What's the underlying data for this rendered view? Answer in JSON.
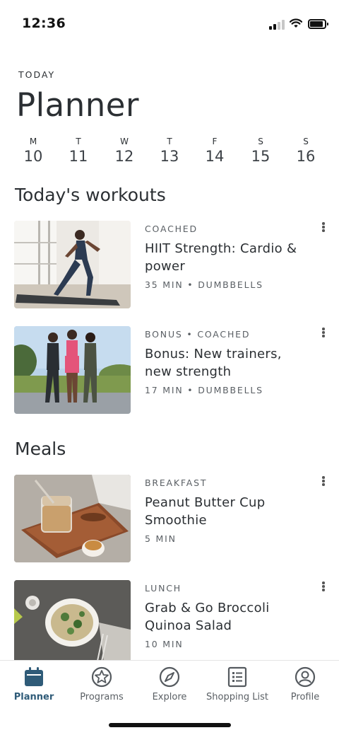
{
  "status_bar": {
    "time": "12:36"
  },
  "header": {
    "eyebrow": "TODAY",
    "title": "Planner"
  },
  "week": [
    {
      "dow": "M",
      "date": "10",
      "selected": false
    },
    {
      "dow": "T",
      "date": "11",
      "selected": false
    },
    {
      "dow": "W",
      "date": "12",
      "selected": true
    },
    {
      "dow": "T",
      "date": "13",
      "selected": false
    },
    {
      "dow": "F",
      "date": "14",
      "selected": false
    },
    {
      "dow": "S",
      "date": "15",
      "selected": false
    },
    {
      "dow": "S",
      "date": "16",
      "selected": false
    }
  ],
  "workouts": {
    "heading": "Today's workouts",
    "items": [
      {
        "kicker": "COACHED",
        "title": "HIIT Strength: Cardio & power",
        "detail": "35 MIN • DUMBBELLS"
      },
      {
        "kicker": "BONUS • COACHED",
        "title": "Bonus: New trainers, new strength",
        "detail": "17 MIN • DUMBBELLS"
      }
    ]
  },
  "meals": {
    "heading": "Meals",
    "items": [
      {
        "kicker": "BREAKFAST",
        "title": "Peanut Butter Cup Smoothie",
        "detail": "5 MIN"
      },
      {
        "kicker": "LUNCH",
        "title": "Grab & Go Broccoli Quinoa Salad",
        "detail": "10 MIN"
      }
    ]
  },
  "tabs": [
    {
      "label": "Planner",
      "icon": "calendar-icon",
      "active": true
    },
    {
      "label": "Programs",
      "icon": "star-badge-icon",
      "active": false
    },
    {
      "label": "Explore",
      "icon": "compass-icon",
      "active": false
    },
    {
      "label": "Shopping List",
      "icon": "list-icon",
      "active": false
    },
    {
      "label": "Profile",
      "icon": "profile-icon",
      "active": false
    }
  ],
  "colors": {
    "accent": "#2f5b78",
    "selected_day": "#f6dc7e",
    "text": "#2b2f33"
  }
}
